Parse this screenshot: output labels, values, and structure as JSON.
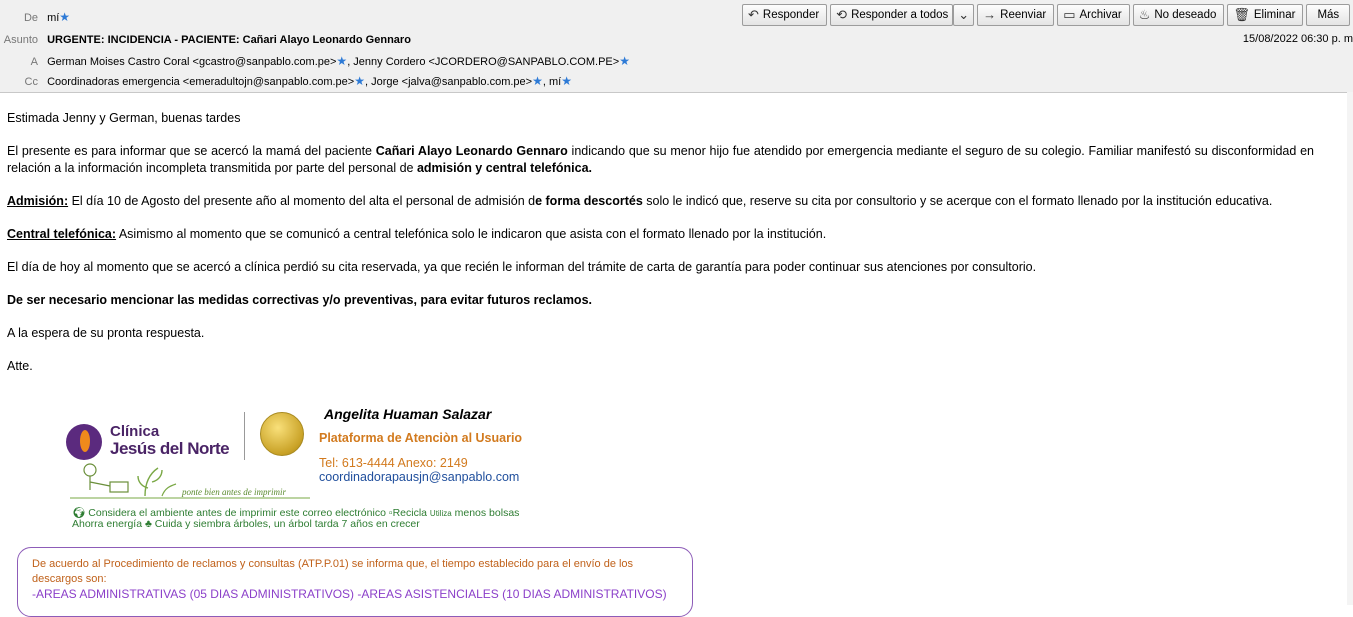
{
  "header": {
    "from_label": "De",
    "from_value": "mí",
    "subject_label": "Asunto",
    "subject_value": "URGENTE: INCIDENCIA - PACIENTE: Cañari Alayo Leonardo Gennaro",
    "to_label": "A",
    "to_1": "German Moises Castro Coral <gcastro@sanpablo.com.pe>",
    "to_2": ", Jenny Cordero <JCORDERO@SANPABLO.COM.PE>",
    "cc_label": "Cc",
    "cc_1": "Coordinadoras emergencia <emeradultojn@sanpablo.com.pe>",
    "cc_2": ", Jorge <jalva@sanpablo.com.pe>",
    "cc_3": ", mí",
    "date": "15/08/2022 06:30 p. m"
  },
  "toolbar": {
    "reply": "Responder",
    "reply_all": "Responder a todos",
    "forward": "Reenviar",
    "archive": "Archivar",
    "junk": "No deseado",
    "delete": "Eliminar",
    "more": "Más"
  },
  "body": {
    "greeting": "Estimada Jenny y German, buenas tardes",
    "p1_a": "El presente es para informar que se acercó la mamá del paciente ",
    "p1_b": "Cañari Alayo Leonardo Gennaro",
    "p1_c": " indicando que su menor hijo fue atendido por emergencia mediante el seguro de su colegio. Familiar manifestó su disconformidad en relación a la información incompleta transmitida por parte del personal de ",
    "p1_d": "admisión  y central telefónica.",
    "p2_label": "Admisión:",
    "p2_a": " El día 10 de Agosto del presente año al momento del alta el personal de admisión d",
    "p2_b": "e forma descortés",
    "p2_c": " solo le indicó que,  reserve su cita por consultorio y se acerque con el formato llenado por la institución educativa.",
    "p3_label": "Central telefónica:",
    "p3_a": " Asimismo al momento que se comunicó a central telefónica solo le indicaron que asista con el formato llenado por la institución.",
    "p4": "El día de hoy al momento que se acercó a clínica perdió su cita reservada, ya que recién le informan del trámite de carta de garantía para poder continuar sus atenciones por consultorio.",
    "p5": "De ser necesario mencionar las medidas correctivas y/o preventivas, para evitar futuros reclamos.",
    "p6": "A la espera de su pronta respuesta.",
    "p7": "Atte."
  },
  "signature": {
    "logo_line1": "Clínica",
    "logo_line2": "Jesús del Norte",
    "name": "Angelita Huaman Salazar",
    "platform": "Plataforma de Atenciòn al Usuario",
    "tel": "Tel: 613-4444   Anexo: 2149",
    "email": "coordinadorapausjn@sanpablo.com",
    "slogan": "ponte bien antes de imprimir",
    "eco1_a": "Considera el ambiente antes de imprimir este correo electrónico",
    "eco1_b": "Recicla",
    "eco1_c": "Utiliza",
    "eco1_d": "menos bolsas",
    "eco2_a": "Ahorra energía",
    "eco2_b": "Cuida y siembra árboles, un árbol tarda 7 años en crecer"
  },
  "notice": {
    "text": "De acuerdo al Procedimiento de reclamos y consultas (ATP.P.01) se informa que, el tiempo establecido para el envío de los descargos son:",
    "areas": "-AREAS ADMINISTRATIVAS (05 DIAS ADMINISTRATIVOS)  -AREAS ASISTENCIALES (10 DIAS ADMINISTRATIVOS)"
  }
}
